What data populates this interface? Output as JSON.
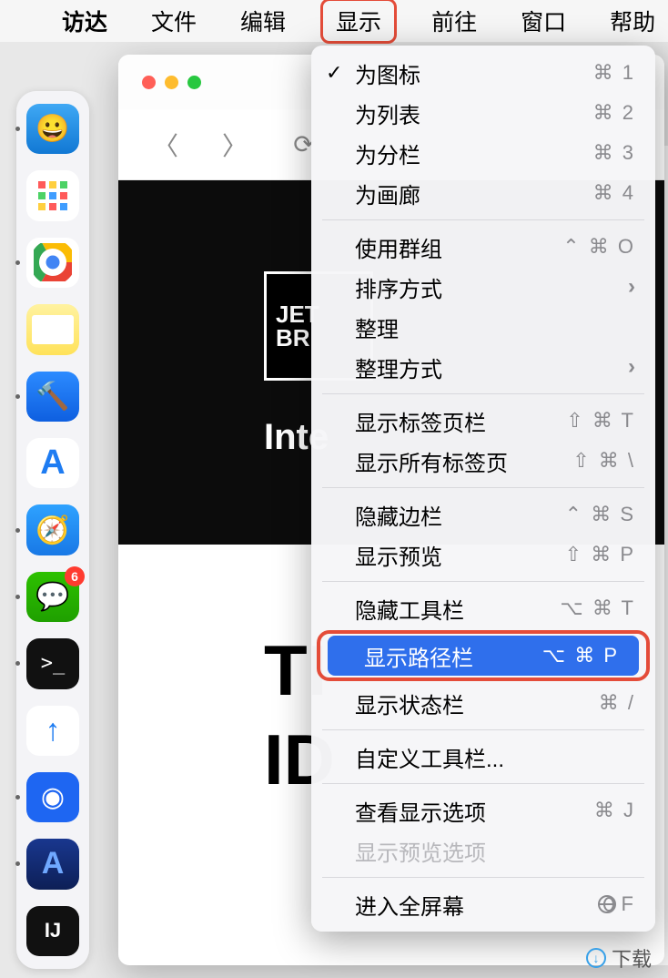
{
  "menubar": {
    "finder": "访达",
    "file": "文件",
    "edit": "编辑",
    "view": "显示",
    "go": "前往",
    "window": "窗口",
    "help": "帮助"
  },
  "dock": {
    "wechat_badge": "6"
  },
  "finder_window": {
    "jet1": "JET",
    "jet2": "BR",
    "inte": "Inte",
    "big1": "TI",
    "big2": "ID"
  },
  "menu": {
    "as_icons": {
      "label": "为图标",
      "shortcut": "⌘ 1"
    },
    "as_list": {
      "label": "为列表",
      "shortcut": "⌘ 2"
    },
    "as_columns": {
      "label": "为分栏",
      "shortcut": "⌘ 3"
    },
    "as_gallery": {
      "label": "为画廊",
      "shortcut": "⌘ 4"
    },
    "use_groups": {
      "label": "使用群组",
      "shortcut": "⌃ ⌘ O"
    },
    "sort_by": {
      "label": "排序方式"
    },
    "clean_up": {
      "label": "整理"
    },
    "clean_up_by": {
      "label": "整理方式"
    },
    "show_tab_bar": {
      "label": "显示标签页栏",
      "shortcut": "⇧ ⌘ T"
    },
    "show_all_tabs": {
      "label": "显示所有标签页",
      "shortcut": "⇧ ⌘ \\"
    },
    "hide_sidebar": {
      "label": "隐藏边栏",
      "shortcut": "⌃ ⌘ S"
    },
    "show_preview": {
      "label": "显示预览",
      "shortcut": "⇧ ⌘ P"
    },
    "hide_toolbar": {
      "label": "隐藏工具栏",
      "shortcut": "⌥ ⌘ T"
    },
    "show_path_bar": {
      "label": "显示路径栏",
      "shortcut": "⌥ ⌘ P"
    },
    "show_status_bar": {
      "label": "显示状态栏",
      "shortcut": "⌘ /"
    },
    "customize_toolbar": {
      "label": "自定义工具栏..."
    },
    "view_options": {
      "label": "查看显示选项",
      "shortcut": "⌘ J"
    },
    "preview_options": {
      "label": "显示预览选项"
    },
    "enter_fullscreen": {
      "label": "进入全屏幕",
      "shortcut": "F"
    }
  },
  "bottom": {
    "download": "下载"
  }
}
